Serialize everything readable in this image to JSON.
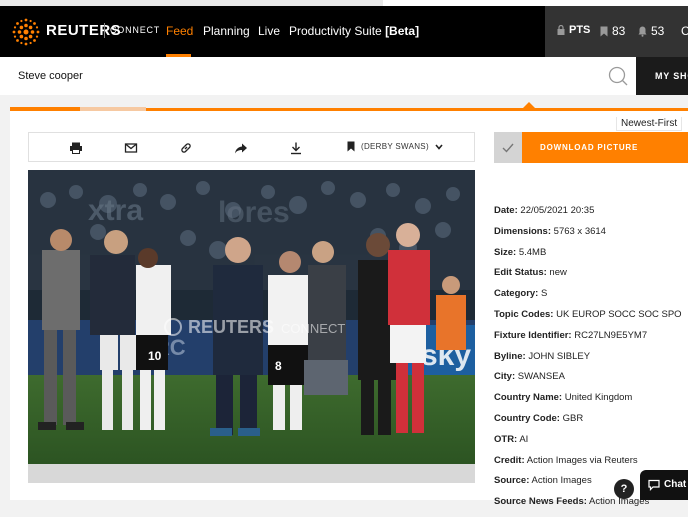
{
  "brand": {
    "name": "REUTERS",
    "sub": "CONNECT"
  },
  "nav": {
    "items": [
      {
        "label": "Feed"
      },
      {
        "label": "Planning"
      },
      {
        "label": "Live"
      },
      {
        "label": "Productivity Suite",
        "suffix": "[Beta]"
      }
    ]
  },
  "status": {
    "pts_label": "PTS",
    "bookmarks": "83",
    "alerts": "53",
    "extra": "C"
  },
  "search": {
    "value": "Steve cooper",
    "my_button": "MY SHO"
  },
  "sort": {
    "label": "Newest-First"
  },
  "toolbar": {
    "collection": "(DERBY SWANS)"
  },
  "photo": {
    "watermark_brand": "REUTERS",
    "watermark_sub": "CONNECT",
    "player_number": "8"
  },
  "download": {
    "label": "DOWNLOAD PICTURE"
  },
  "meta": [
    {
      "label": "Date:",
      "value": "22/05/2021 20:35"
    },
    {
      "label": "Dimensions:",
      "value": "5763 x 3614"
    },
    {
      "label": "Size:",
      "value": "5.4MB"
    },
    {
      "label": "Edit Status:",
      "value": "new"
    },
    {
      "label": "Category:",
      "value": "S"
    },
    {
      "label": "Topic Codes:",
      "value": "UK EUROP SOCC SOC SPO"
    },
    {
      "label": "Fixture Identifier:",
      "value": "RC27LN9E5YM7"
    },
    {
      "label": "Byline:",
      "value": "JOHN SIBLEY"
    },
    {
      "label": "City:",
      "value": "SWANSEA"
    },
    {
      "label": "Country Name:",
      "value": "United Kingdom"
    },
    {
      "label": "Country Code:",
      "value": "GBR"
    },
    {
      "label": "OTR:",
      "value": "AI"
    },
    {
      "label": "Credit:",
      "value": "Action Images via Reuters"
    },
    {
      "label": "Source:",
      "value": "Action Images"
    },
    {
      "label": "Source News Feeds:",
      "value": "Action Images"
    }
  ],
  "chat": {
    "label": "Chat",
    "help": "?"
  },
  "colors": {
    "accent": "#ff8000",
    "navbar": "#000000",
    "panel": "#333333"
  }
}
